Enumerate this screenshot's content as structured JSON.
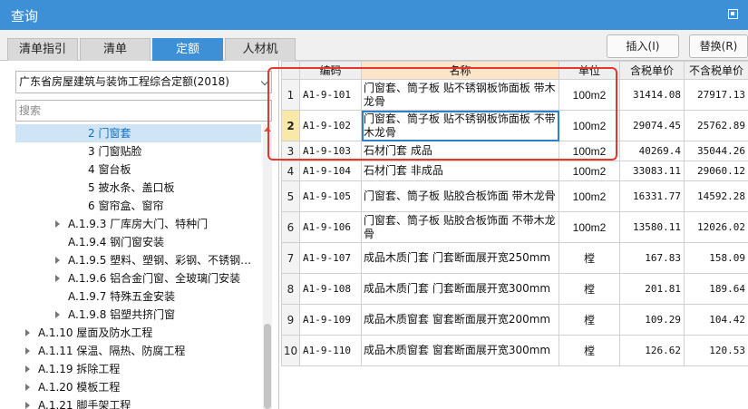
{
  "window": {
    "title": "查询"
  },
  "tabs": [
    {
      "label": "清单指引",
      "active": false
    },
    {
      "label": "清单",
      "active": false
    },
    {
      "label": "定额",
      "active": true
    },
    {
      "label": "人材机",
      "active": false
    }
  ],
  "toolbar": {
    "insert_label": "插入(I)",
    "replace_label": "替换(R)"
  },
  "left": {
    "quota_library": "广东省房屋建筑与装饰工程综合定额(2018)",
    "search_placeholder": "搜索",
    "tree": [
      {
        "label": "2 门窗套",
        "level": 3,
        "expandable": false,
        "selected": true
      },
      {
        "label": "3 门窗贴脸",
        "level": 3,
        "expandable": false,
        "selected": false
      },
      {
        "label": "4 窗台板",
        "level": 3,
        "expandable": false,
        "selected": false
      },
      {
        "label": "5 披水条、盖口板",
        "level": 3,
        "expandable": false,
        "selected": false
      },
      {
        "label": "6 窗帘盒、窗帘",
        "level": 3,
        "expandable": false,
        "selected": false
      },
      {
        "label": "A.1.9.3 厂库房大门、特种门",
        "level": 2,
        "expandable": true,
        "selected": false
      },
      {
        "label": "A.1.9.4 钢门窗安装",
        "level": 2,
        "expandable": false,
        "selected": false
      },
      {
        "label": "A.1.9.5 塑料、塑钢、彩钢、不锈钢…",
        "level": 2,
        "expandable": true,
        "selected": false
      },
      {
        "label": "A.1.9.6 铝合金门窗、全玻璃门安装",
        "level": 2,
        "expandable": true,
        "selected": false
      },
      {
        "label": "A.1.9.7 特殊五金安装",
        "level": 2,
        "expandable": false,
        "selected": false
      },
      {
        "label": "A.1.9.8 铝塑共挤门窗",
        "level": 2,
        "expandable": true,
        "selected": false
      },
      {
        "label": "A.1.10 屋面及防水工程",
        "level": 1,
        "expandable": true,
        "selected": false
      },
      {
        "label": "A.1.11 保温、隔热、防腐工程",
        "level": 1,
        "expandable": true,
        "selected": false
      },
      {
        "label": "A.1.19 拆除工程",
        "level": 1,
        "expandable": true,
        "selected": false
      },
      {
        "label": "A.1.20 模板工程",
        "level": 1,
        "expandable": true,
        "selected": false
      },
      {
        "label": "A.1.21 脚手架工程",
        "level": 1,
        "expandable": true,
        "selected": false
      }
    ]
  },
  "table": {
    "columns": [
      "",
      "编码",
      "名称",
      "单位",
      "含税单价",
      "不含税单价"
    ],
    "rows": [
      {
        "idx": "1",
        "code": "A1-9-101",
        "name": "门窗套、筒子板 贴不锈钢板饰面板 带木龙骨",
        "unit": "100m2",
        "tax_price": "31414.08",
        "notax_price": "27917.13"
      },
      {
        "idx": "2",
        "code": "A1-9-102",
        "name": "门窗套、筒子板 贴不锈钢板饰面板 不带木龙骨",
        "unit": "100m2",
        "tax_price": "29074.45",
        "notax_price": "25762.89"
      },
      {
        "idx": "3",
        "code": "A1-9-103",
        "name": "石材门套 成品",
        "unit": "100m2",
        "tax_price": "40269.4",
        "notax_price": "35044.26"
      },
      {
        "idx": "4",
        "code": "A1-9-104",
        "name": "石材门套 非成品",
        "unit": "100m2",
        "tax_price": "33083.11",
        "notax_price": "29060.12"
      },
      {
        "idx": "5",
        "code": "A1-9-105",
        "name": "门窗套、筒子板 贴胶合板饰面 带木龙骨",
        "unit": "100m2",
        "tax_price": "16331.77",
        "notax_price": "14592.28"
      },
      {
        "idx": "6",
        "code": "A1-9-106",
        "name": "门窗套、筒子板 贴胶合板饰面 不带木龙骨",
        "unit": "100m2",
        "tax_price": "13580.11",
        "notax_price": "12026.02"
      },
      {
        "idx": "7",
        "code": "A1-9-107",
        "name": "成品木质门套 门套断面展开宽250mm",
        "unit": "樘",
        "tax_price": "167.83",
        "notax_price": "158.09"
      },
      {
        "idx": "8",
        "code": "A1-9-108",
        "name": "成品木质门套 门套断面展开宽300mm",
        "unit": "樘",
        "tax_price": "201.81",
        "notax_price": "189.64"
      },
      {
        "idx": "9",
        "code": "A1-9-109",
        "name": "成品木质窗套 窗套断面展开宽200mm",
        "unit": "樘",
        "tax_price": "109.29",
        "notax_price": "104.42"
      },
      {
        "idx": "10",
        "code": "A1-9-110",
        "name": "成品木质窗套 窗套断面展开宽300mm",
        "unit": "樘",
        "tax_price": "126.62",
        "notax_price": "120.53"
      }
    ],
    "current_row": 2
  },
  "colors": {
    "titlebar": "#3d8fd6",
    "active_tab": "#3d8fd6",
    "highlight_box": "#e8362f",
    "selected_tree": "#cfe4f7"
  }
}
